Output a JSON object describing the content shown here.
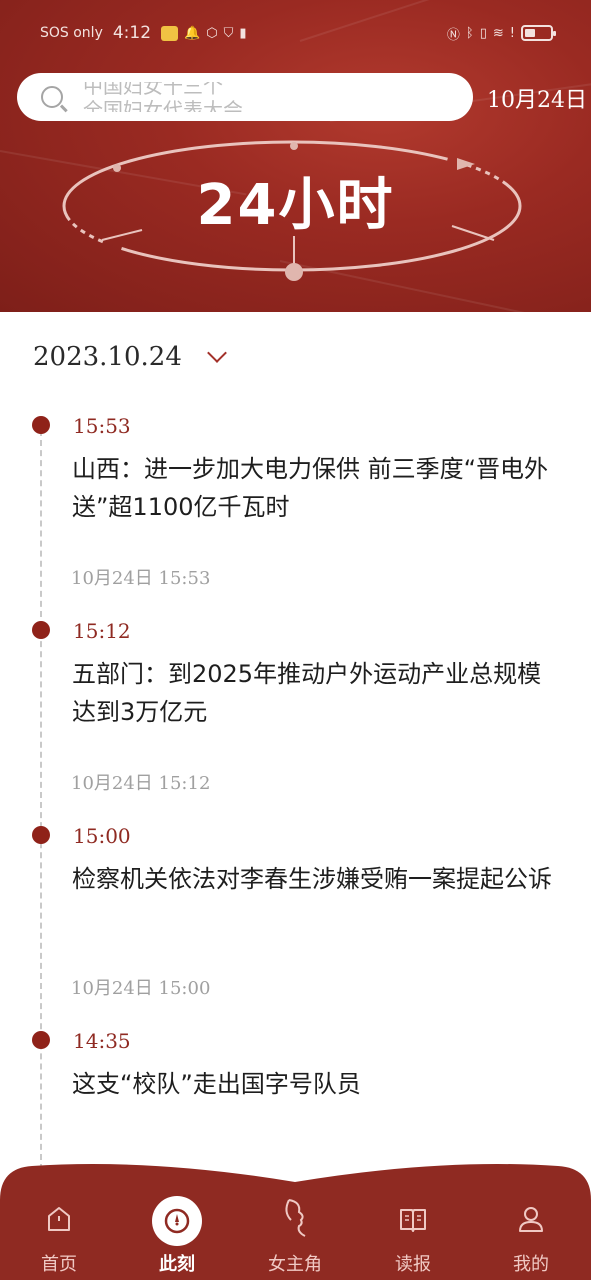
{
  "status_bar": {
    "carrier": "SOS only",
    "time": "4:12",
    "right_icons": [
      "nfc-icon",
      "bluetooth-icon",
      "vibrate-icon",
      "wifi-icon",
      "alert-icon",
      "battery-icon"
    ],
    "battery_level": 0.3
  },
  "header": {
    "search_placeholder_line1": "中国妇女十三个",
    "search_placeholder_line2": "全国妇女代表大会",
    "date": "10月24日",
    "banner_title": "24小时",
    "bg_color": "#9a2a22"
  },
  "date_selector": {
    "value": "2023.10.24"
  },
  "news": [
    {
      "time": "15:53",
      "title": "山西：进一步加大电力保供 前三季度“晋电外送”超1100亿千瓦时",
      "meta": "10月24日 15:53"
    },
    {
      "time": "15:12",
      "title": "五部门：到2025年推动户外运动产业总规模达到3万亿元",
      "meta": "10月24日 15:12"
    },
    {
      "time": "15:00",
      "title": "检察机关依法对李春生涉嫌受贿一案提起公诉",
      "meta": "10月24日 15:00"
    },
    {
      "time": "14:35",
      "title": "这支“校队”走出国字号队员",
      "meta": ""
    }
  ],
  "bottom_nav": {
    "items": [
      {
        "label": "首页",
        "icon": "home-icon",
        "active": false
      },
      {
        "label": "此刻",
        "icon": "compass-icon",
        "active": true
      },
      {
        "label": "女主角",
        "icon": "profile-silhouette-icon",
        "active": false
      },
      {
        "label": "读报",
        "icon": "newspaper-icon",
        "active": false
      },
      {
        "label": "我的",
        "icon": "user-icon",
        "active": false
      }
    ],
    "bg_color": "#8f2a22"
  }
}
